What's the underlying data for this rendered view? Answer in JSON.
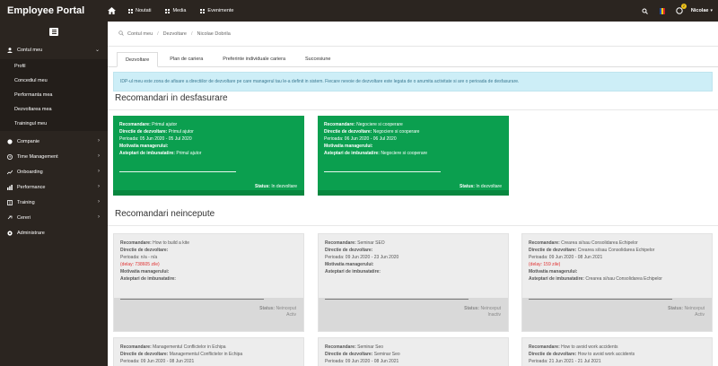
{
  "brand": "Employee Portal",
  "topnav": [
    {
      "label": "Noutati",
      "icon": "grid-icon"
    },
    {
      "label": "Media",
      "icon": "grid-icon"
    },
    {
      "label": "Evenimente",
      "icon": "grid-icon"
    }
  ],
  "user": {
    "name": "Nicolae",
    "notifications": "2"
  },
  "sidebar": {
    "groups": [
      {
        "label": "Contul meu",
        "icon": "user-icon",
        "expanded": true
      },
      {
        "label": "Companie",
        "icon": "globe-icon"
      },
      {
        "label": "Time Management",
        "icon": "clock-icon"
      },
      {
        "label": "Onboarding",
        "icon": "chart-icon"
      },
      {
        "label": "Performance",
        "icon": "bars-icon"
      },
      {
        "label": "Training",
        "icon": "book-icon"
      },
      {
        "label": "Cereri",
        "icon": "link-icon"
      },
      {
        "label": "Administrare",
        "icon": "gear-icon"
      }
    ],
    "subitems": [
      "Profil",
      "Concediul meu",
      "Performanta mea",
      "Dezvoltarea mea",
      "Trainingul meu"
    ]
  },
  "breadcrumb": [
    "Contul meu",
    "Dezvoltare",
    "Nicolae Dobrila"
  ],
  "tabs": [
    "Dezvoltare",
    "Plan de cariera",
    "Preferinte individuale cariera",
    "Succesiune"
  ],
  "info": "IDP-ul meu este zona de afisare a directiilor de dezvoltare pe care managerul tau le-a definit in sistem. Fiecare nevoie de dezvoltare este legata de o anumita activitate si are o perioada de desfasurare.",
  "section1": "Recomandari in desfasurare",
  "section2": "Recomandari neincepute",
  "labels": {
    "rec": "Recomandare:",
    "dir": "Directie de dezvoltare:",
    "period": "Perioada:",
    "motiv": "Motivatia managerului:",
    "expect": "Asteptari de imbunatatire:",
    "status": "Status:"
  },
  "ongoing": [
    {
      "rec": "Primul ajutor",
      "dir": "Primul ajutor",
      "period": "05 Jun 2020 - 05 Jul 2020",
      "expect": "Primul ajutor",
      "status": "In dezvoltare"
    },
    {
      "rec": "Negociere si cooperare",
      "dir": "Negociere si cooperare",
      "period": "06 Jun 2020 - 06 Jul 2020",
      "expect": "Negociere si cooperare",
      "status": "In dezvoltare"
    }
  ],
  "notstarted": [
    {
      "rec": "How to build a kite",
      "dir": "",
      "period": "n/a - n/a",
      "delay": "(delay: 738605 zile)",
      "expect": "",
      "status": "Neinceput",
      "state": "Activ"
    },
    {
      "rec": "Seminar SEO",
      "dir": "",
      "period": "09 Jun 2020 - 23 Jun 2020",
      "delay": "",
      "expect": "",
      "status": "Neinceput",
      "state": "Inactiv"
    },
    {
      "rec": "Crearea si/sau Consolidarea Echipelor",
      "dir": "Crearea si/sau Consolidarea Echipelor",
      "period": "09 Jun 2020 - 08 Jun 2021",
      "delay": "(delay: 159 zile)",
      "expect": "Crearea si/sau Consolidarea Echipelor",
      "status": "Neinceput",
      "state": "Activ"
    },
    {
      "rec": "Managementul Conflictelor in Echipa",
      "dir": "Managementul Conflictelor in Echipa",
      "period": "09 Jun 2020 - 08 Jun 2021"
    },
    {
      "rec": "Seminar Seo",
      "dir": "Seminar Seo",
      "period": "09 Jun 2020 - 08 Jun 2021"
    },
    {
      "rec": "How to avoid work accidents",
      "dir": "How to avoid work accidents",
      "period": "21 Jun 2021 - 21 Jul 2021"
    }
  ]
}
